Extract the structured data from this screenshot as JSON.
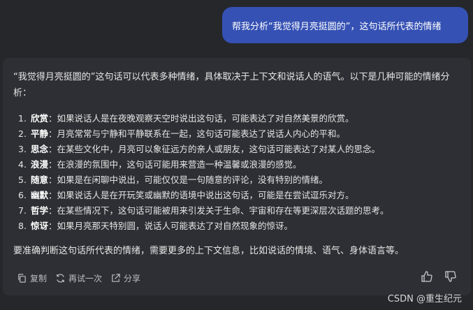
{
  "user_message": "帮我分析“我觉得月亮挺圆的”，这句话所代表的情绪",
  "answer": {
    "intro": "“我觉得月亮挺圆的”这句话可以代表多种情绪，具体取决于上下文和说话人的语气。以下是几种可能的情绪分析：",
    "items": [
      {
        "num": "1.",
        "term": "欣赏",
        "text": "：如果说话人是在夜晚观察天空时说出这句话，可能表达了对自然美景的欣赏。"
      },
      {
        "num": "2.",
        "term": "平静",
        "text": "：月亮常常与宁静和平静联系在一起，这句话可能表达了说话人内心的平和。"
      },
      {
        "num": "3.",
        "term": "思念",
        "text": "：在某些文化中，月亮可以象征远方的亲人或朋友，这句话可能表达了对某人的思念。"
      },
      {
        "num": "4.",
        "term": "浪漫",
        "text": "：在浪漫的氛围中，这句话可能用来营造一种温馨或浪漫的感觉。"
      },
      {
        "num": "5.",
        "term": "随意",
        "text": "：如果是在闲聊中说出，可能仅仅是一句随意的评论，没有特别的情绪。"
      },
      {
        "num": "6.",
        "term": "幽默",
        "text": "：如果说话人是在开玩笑或幽默的语境中说出这句话，可能是在尝试逗乐对方。"
      },
      {
        "num": "7.",
        "term": "哲学",
        "text": "：在某些情况下，这句话可能被用来引发关于生命、宇宙和存在等更深层次话题的思考。"
      },
      {
        "num": "8.",
        "term": "惊讶",
        "text": "：如果月亮那天特别圆，说话人可能表达了对自然现象的惊讶。"
      }
    ],
    "conclusion": "要准确判断这句话所代表的情绪，需要更多的上下文信息，比如说话的情境、语气、身体语言等。"
  },
  "toolbar": {
    "copy": "复制",
    "retry": "再试一次",
    "share": "分享"
  },
  "icons": {
    "copy": "copy-icon",
    "retry": "refresh-icon",
    "share": "share-icon",
    "like": "thumbs-up-icon",
    "dislike": "thumbs-down-icon"
  },
  "colors": {
    "user_bubble": "#3551b4",
    "page_bg": "#26272b",
    "card_bg": "#2e2f34"
  },
  "watermark": "CSDN @重生纪元"
}
